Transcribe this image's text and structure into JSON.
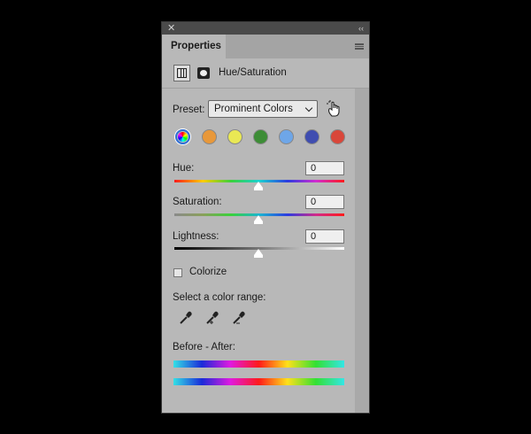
{
  "panel": {
    "tab_title": "Properties",
    "adjustment_title": "Hue/Saturation"
  },
  "preset": {
    "label": "Preset:",
    "value": "Prominent Colors"
  },
  "swatches": [
    "all-colors",
    "orange",
    "yellow",
    "green",
    "light-blue",
    "blue",
    "red"
  ],
  "swatch_colors": {
    "orange": "#e8983a",
    "yellow": "#e9e854",
    "green": "#3d8d36",
    "light-blue": "#6ea6e8",
    "blue": "#3f4db0",
    "red": "#d9473a"
  },
  "sliders": {
    "hue": {
      "label": "Hue:",
      "value": "0"
    },
    "saturation": {
      "label": "Saturation:",
      "value": "0"
    },
    "lightness": {
      "label": "Lightness:",
      "value": "0"
    }
  },
  "colorize": {
    "label": "Colorize",
    "checked": false
  },
  "color_range": {
    "label": "Select a color range:",
    "tools": [
      "eyedropper-icon",
      "eyedropper-add-icon",
      "eyedropper-subtract-icon"
    ]
  },
  "before_after": {
    "label": "Before - After:"
  }
}
